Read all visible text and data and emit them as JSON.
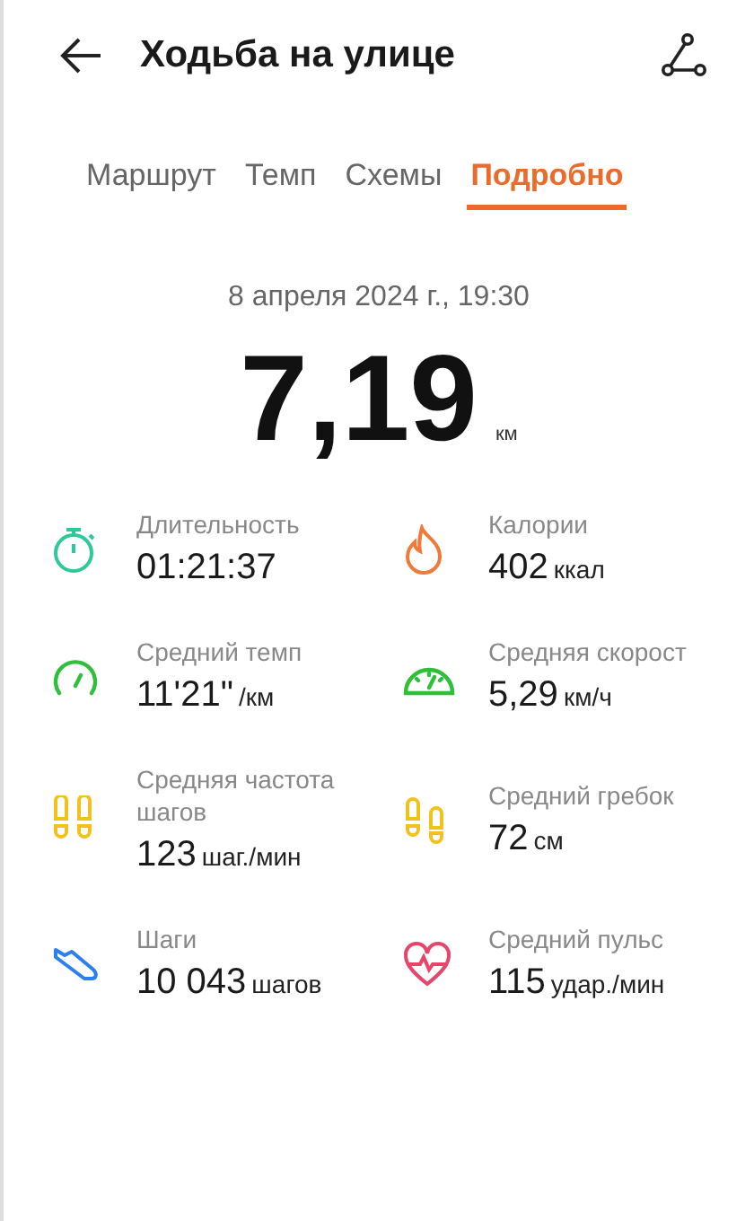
{
  "header": {
    "title": "Ходьба на улице"
  },
  "tabs": [
    {
      "label": "Маршрут",
      "selected": false
    },
    {
      "label": "Темп",
      "selected": false
    },
    {
      "label": "Схемы",
      "selected": false
    },
    {
      "label": "Подробно",
      "selected": true
    }
  ],
  "summary": {
    "date": "8 апреля 2024 г., 19:30",
    "distance": "7,19",
    "unit": "км"
  },
  "stats": [
    {
      "kind": "duration",
      "color": "#2ec99a",
      "label": "Длительность",
      "value": "01:21:37"
    },
    {
      "kind": "calories",
      "color": "#f07a3a",
      "label": "Калории",
      "value": "402",
      "unit": "ккал"
    },
    {
      "kind": "pace",
      "color": "#2fbf3a",
      "label": "Средний темп",
      "value": "11'21\"",
      "unit": "/км"
    },
    {
      "kind": "speed",
      "color": "#2fbf3a",
      "label": "Средняя скорост",
      "value": "5,29",
      "unit": "км/ч"
    },
    {
      "kind": "cadence",
      "color": "#f2c21c",
      "label": "Средняя частота шагов",
      "value": "123",
      "unit": "шаг./мин"
    },
    {
      "kind": "stride",
      "color": "#f2c21c",
      "label": "Средний гребок",
      "value": "72",
      "unit": "см"
    },
    {
      "kind": "steps",
      "color": "#2b7ff0",
      "label": "Шаги",
      "value": "10 043",
      "unit": "шагов"
    },
    {
      "kind": "heart",
      "color": "#e8456a",
      "label": "Средний пульс",
      "value": "115",
      "unit": "удар./мин"
    }
  ]
}
